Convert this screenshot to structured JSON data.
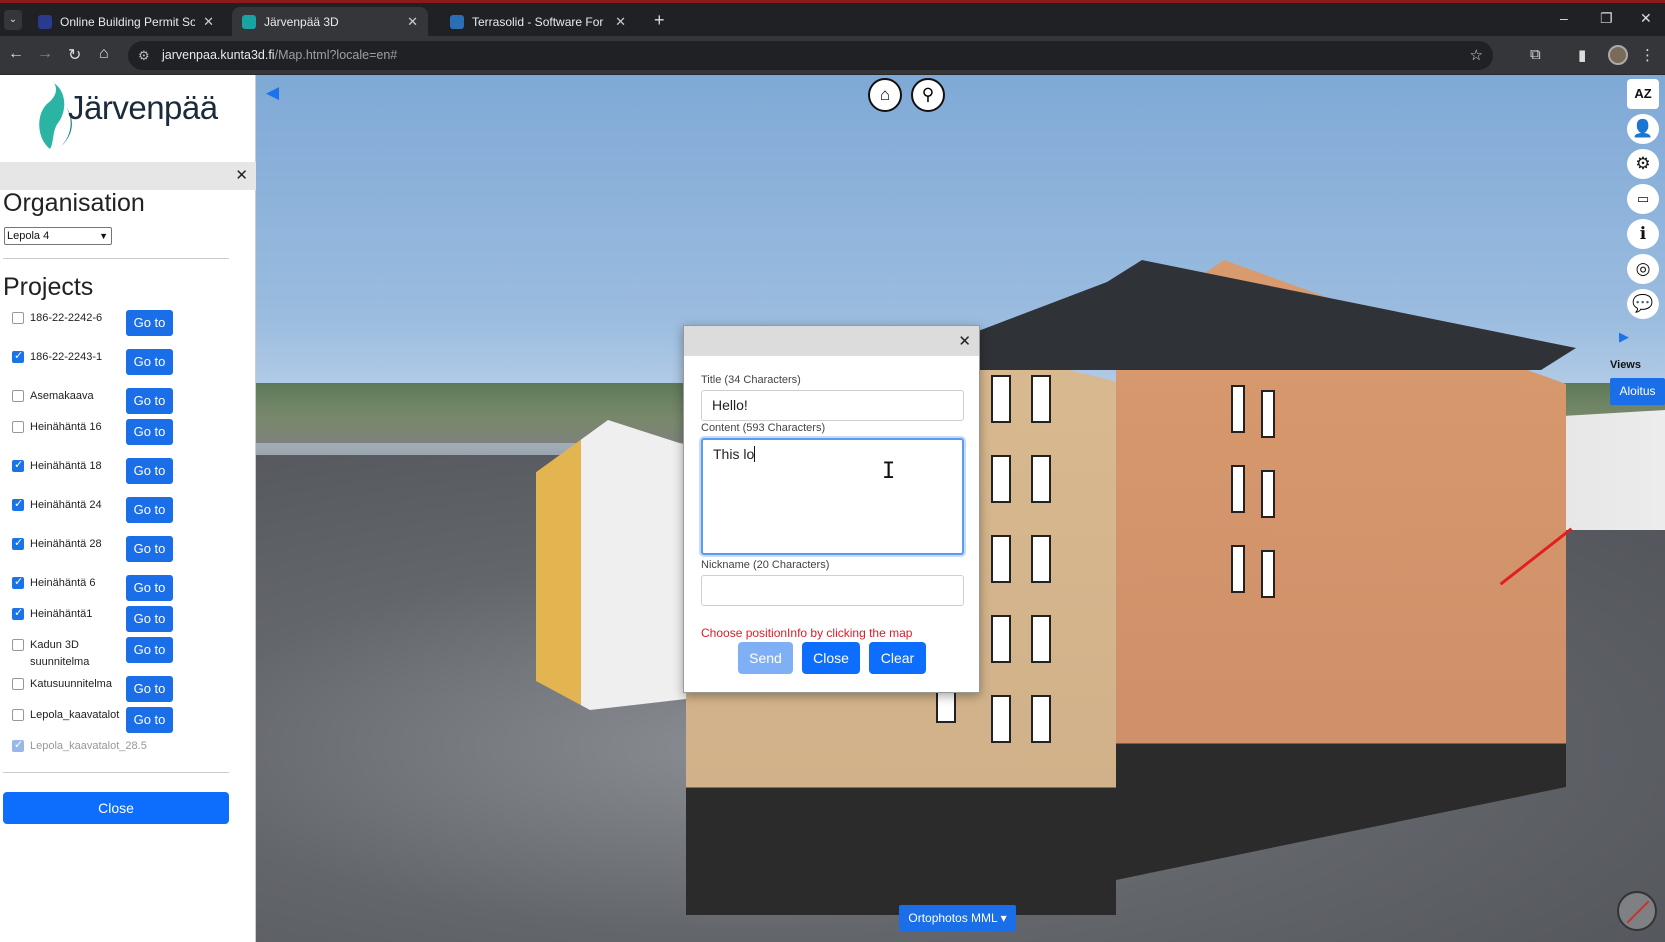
{
  "browser": {
    "tabs": [
      {
        "title": "Online Building Permit Software",
        "active": false
      },
      {
        "title": "Järvenpää 3D",
        "active": true
      },
      {
        "title": "Terrasolid - Software For Point Cloud",
        "active": false
      }
    ],
    "url_host": "jarvenpaa.kunta3d.fi",
    "url_path": "/Map.html?locale=en#"
  },
  "sidebar": {
    "logo_text": "Järvenpää",
    "organisation_heading": "Organisation",
    "organisation_selected": "Lepola 4",
    "projects_heading": "Projects",
    "go_label": "Go to",
    "projects": [
      {
        "name": "186-22-2242-6",
        "checked": false
      },
      {
        "name": "186-22-2243-1",
        "checked": true
      },
      {
        "name": "Asemakaava",
        "checked": false
      },
      {
        "name": "Heinähäntä 16",
        "checked": false
      },
      {
        "name": "Heinähäntä 18",
        "checked": true
      },
      {
        "name": "Heinähäntä 24",
        "checked": true
      },
      {
        "name": "Heinähäntä 28",
        "checked": true
      },
      {
        "name": "Heinähäntä 6",
        "checked": true
      },
      {
        "name": "Heinähäntä1",
        "checked": true
      },
      {
        "name": "Kadun 3D suunnitelma",
        "checked": false
      },
      {
        "name": "Katusuunnitelma",
        "checked": false
      },
      {
        "name": "Lepola_kaavatalot",
        "checked": false
      },
      {
        "name": "Lepola_kaavatalot_28.5",
        "checked": true,
        "disabled": true
      }
    ],
    "close_label": "Close"
  },
  "map": {
    "views_label": "Views",
    "view_button": "Aloitus",
    "layer_button": "Ortophotos MML ▾"
  },
  "dialog": {
    "title_label": "Title (34 Characters)",
    "title_value": "Hello!",
    "content_label": "Content (593 Characters)",
    "content_value": "This lo",
    "nickname_label": "Nickname (20 Characters)",
    "nickname_value": "",
    "warning": "Choose positionInfo by clicking the map",
    "send_label": "Send",
    "close_label": "Close",
    "clear_label": "Clear"
  },
  "colors": {
    "primary": "#0d6efd",
    "warning": "#d8202a"
  }
}
